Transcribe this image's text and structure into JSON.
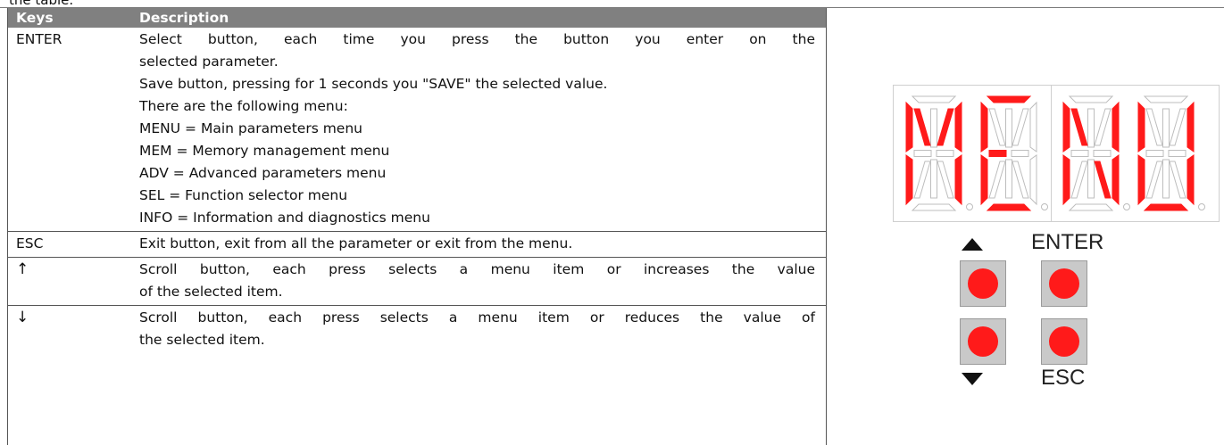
{
  "clipped_caption": "the table.",
  "table": {
    "headers": {
      "keys": "Keys",
      "description": "Description"
    },
    "rows": [
      {
        "key": "ENTER",
        "lines": [
          "Select button, each time you press the button you enter on the",
          "selected parameter.",
          "Save button, pressing for 1 seconds you \"SAVE\" the selected value.",
          "There are the following menu:",
          "MENU = Main parameters menu",
          "MEM = Memory management menu",
          "ADV = Advanced parameters menu",
          "SEL = Function selector menu",
          "INFO = Information and diagnostics menu"
        ]
      },
      {
        "key": "ESC",
        "lines": [
          "Exit button, exit from all the parameter or exit from the menu."
        ]
      },
      {
        "key": "↑",
        "lines": [
          "Scroll button, each press selects a menu item or increases the value",
          "of the selected item."
        ]
      },
      {
        "key": "↓",
        "lines": [
          "Scroll button, each press selects a menu item or reduces the value of",
          "the selected item."
        ]
      }
    ]
  },
  "panel": {
    "display_text": "MENU",
    "enter_label": "ENTER",
    "esc_label": "ESC",
    "colors": {
      "segment_on": "#ff1a1a",
      "segment_off": "#bdbdbd",
      "button_face": "#c9c9c9"
    },
    "icons": {
      "up": "up-triangle-icon",
      "down": "down-triangle-icon"
    }
  }
}
